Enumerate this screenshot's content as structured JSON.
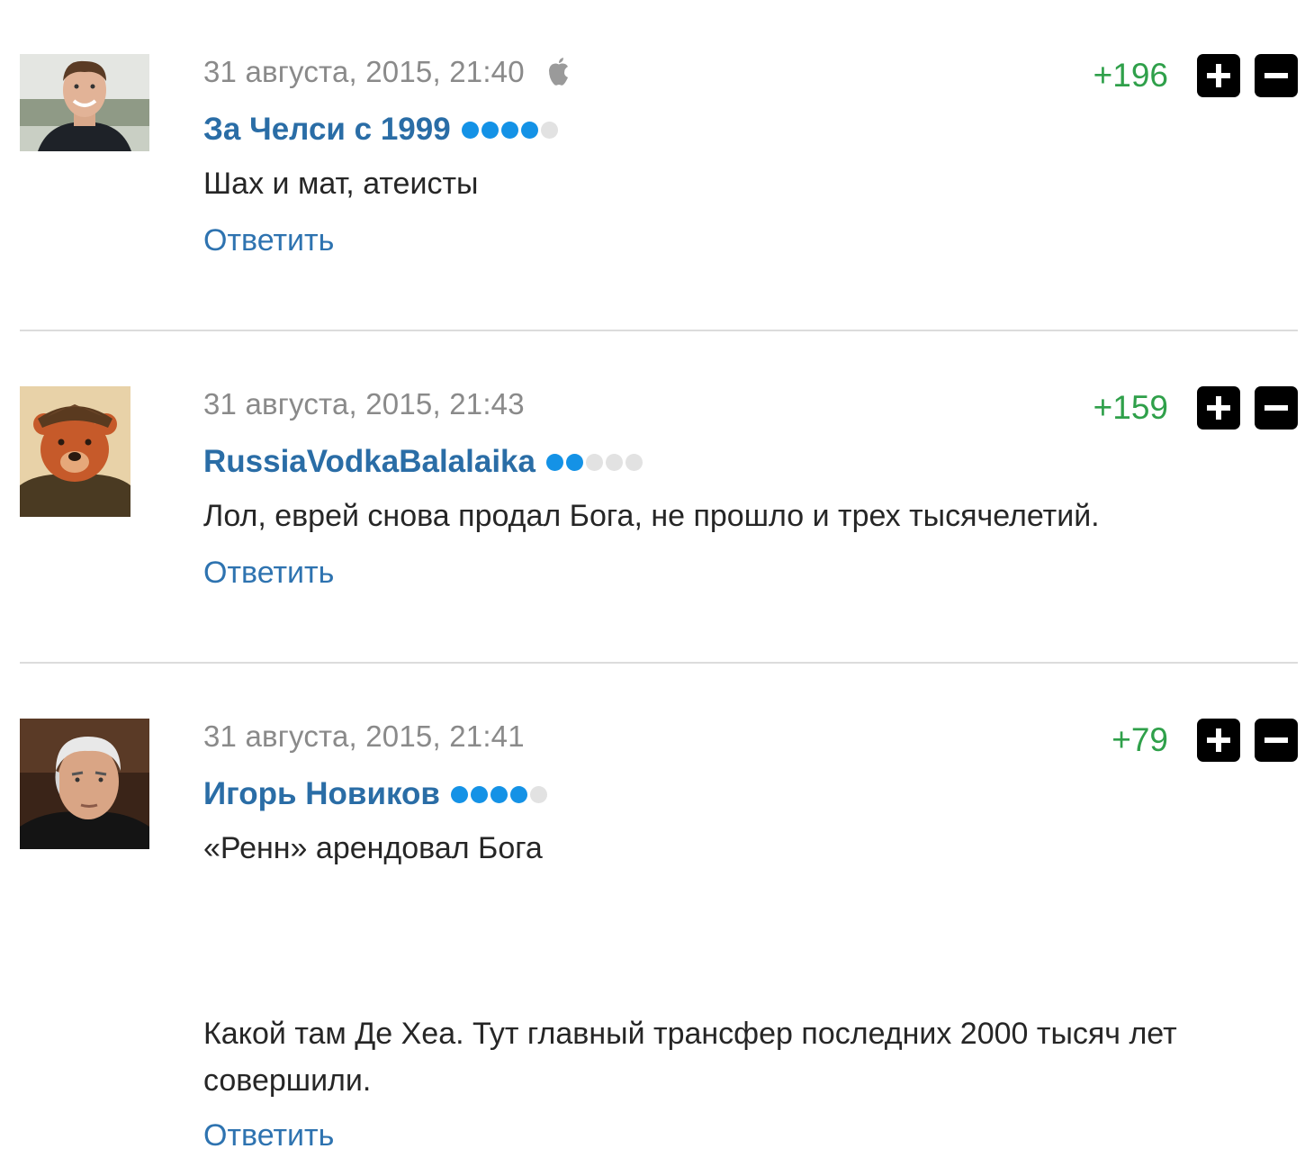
{
  "comments": [
    {
      "date": "31 августа, 2015, 21:40",
      "platform_icon": "apple-icon",
      "username": "За Челси с 1999",
      "rating_dots": {
        "filled": 4,
        "total": 5
      },
      "score": "+196",
      "text": "Шах и мат, атеисты",
      "reply_label": "Ответить",
      "avatar_icon": "smiling-man-avatar"
    },
    {
      "date": "31 августа, 2015, 21:43",
      "username": "RussiaVodkaBalalaika",
      "rating_dots": {
        "filled": 2,
        "total": 5
      },
      "score": "+159",
      "text": "Лол, еврей снова продал Бога, не прошло и трех тысячелетий.",
      "reply_label": "Ответить",
      "avatar_icon": "bear-in-hat-avatar"
    },
    {
      "date": "31 августа, 2015, 21:41",
      "username": "Игорь Новиков",
      "rating_dots": {
        "filled": 4,
        "total": 5
      },
      "score": "+79",
      "text": "«Ренн» арендовал Бога",
      "text_extra": "Какой там Де Хеа. Тут главный трансфер последних 2000 тысяч лет совершили.",
      "reply_label": "Ответить",
      "avatar_icon": "grey-haired-man-avatar"
    }
  ],
  "colors": {
    "username": "#2a6da6",
    "reply": "#2e73b0",
    "score": "#2fa04a",
    "dot_filled": "#1492e6",
    "dot_empty": "#e2e2e2",
    "date": "#8a8a8a"
  }
}
